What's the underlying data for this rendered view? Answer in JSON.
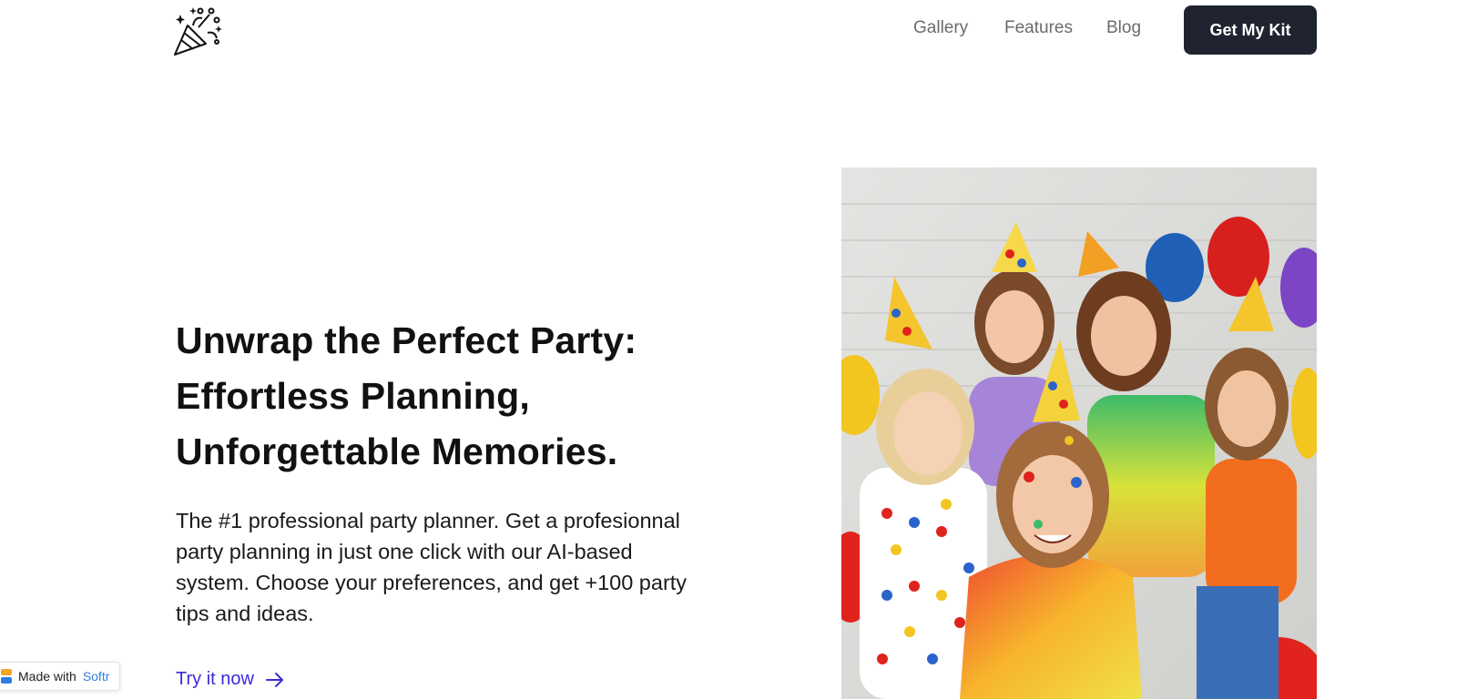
{
  "header": {
    "logo_icon": "party-popper-icon",
    "nav": [
      {
        "label": "Gallery"
      },
      {
        "label": "Features"
      },
      {
        "label": "Blog"
      }
    ],
    "cta_label": "Get My Kit"
  },
  "hero": {
    "headline_lines": [
      "Unwrap the Perfect Party:",
      "Effortless Planning,",
      "Unforgettable Memories."
    ],
    "subtext_lines": [
      "The #1 professional party planner. Get a profesionnal",
      "party planning in just one click with our AI-based",
      "system. Choose your preferences, and get +100 party",
      "tips and ideas."
    ],
    "link_label": "Try it now",
    "link_icon": "arrow-right-icon",
    "image_icon": "kids-party-photo"
  },
  "badge": {
    "prefix": "Made with",
    "brand": "Softr"
  },
  "colors": {
    "cta_bg": "#1f2430",
    "link": "#3b2bd9",
    "nav_text": "#6b6b6b",
    "badge_brand": "#2f7de1"
  }
}
